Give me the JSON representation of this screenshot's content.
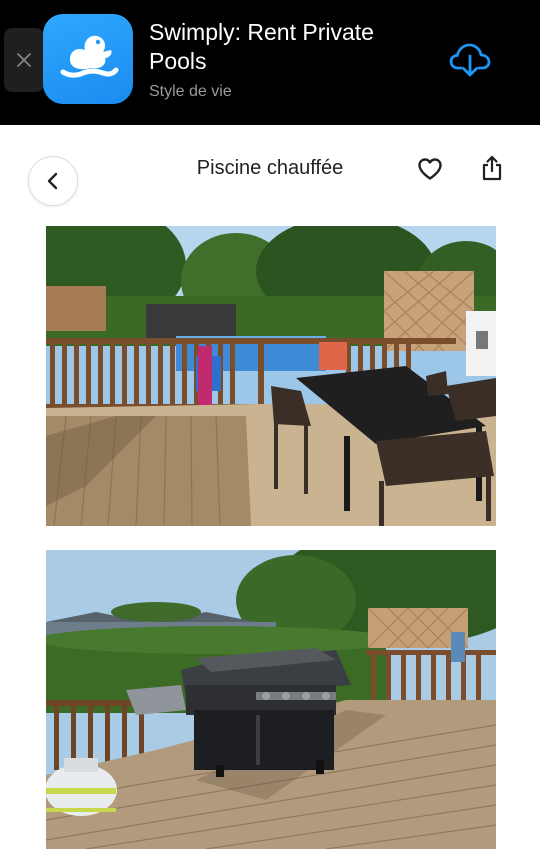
{
  "banner": {
    "app_name": "Swimply: Rent Private Pools",
    "category": "Style de vie",
    "brand_color": "#1d96f5",
    "close_icon": "close-icon",
    "download_icon": "cloud-download-icon"
  },
  "header": {
    "title": "Piscine chauffée",
    "back_icon": "chevron-left-icon",
    "favorite_icon": "heart-icon",
    "share_icon": "share-icon"
  },
  "photos": [
    {
      "subject": "pool-deck-dining-photo"
    },
    {
      "subject": "deck-barbecue-photo"
    }
  ]
}
